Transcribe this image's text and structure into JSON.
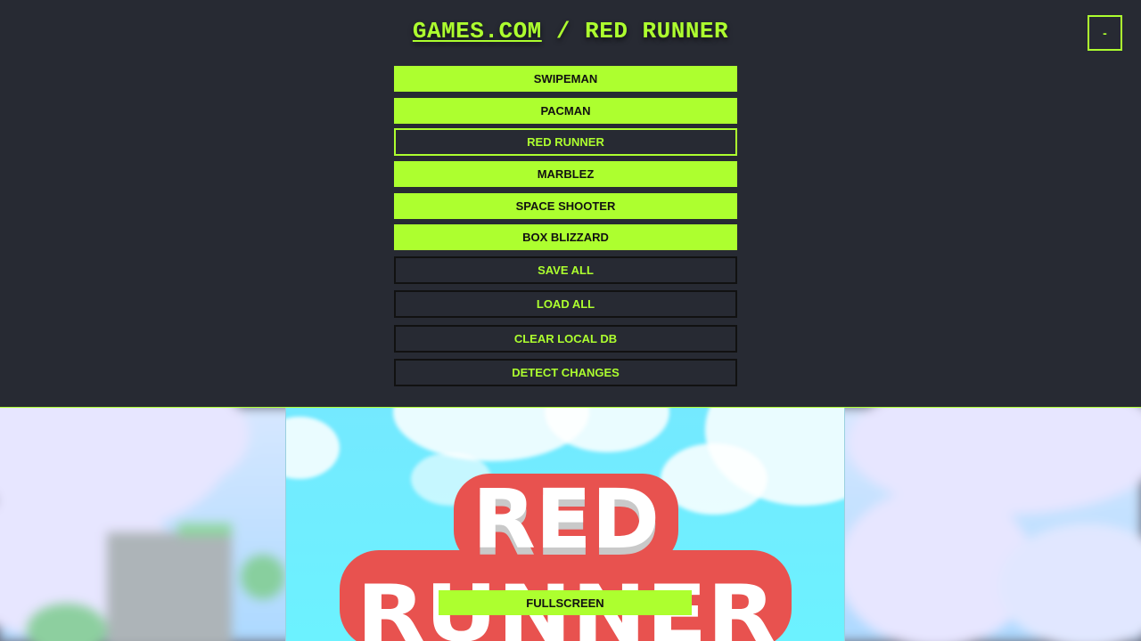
{
  "header": {
    "site_link": "GAMES.COM",
    "separator": " / ",
    "current_game": "RED RUNNER",
    "minimize_label": "-"
  },
  "menu": {
    "games": [
      {
        "label": "SWIPEMAN",
        "active": false
      },
      {
        "label": "PACMAN",
        "active": false
      },
      {
        "label": "RED RUNNER",
        "active": true
      },
      {
        "label": "MARBLEZ",
        "active": false
      },
      {
        "label": "SPACE SHOOTER",
        "active": false
      },
      {
        "label": "BOX BLIZZARD",
        "active": false
      }
    ],
    "actions": [
      {
        "label": "SAVE ALL"
      },
      {
        "label": "LOAD ALL"
      },
      {
        "label": "CLEAR LOCAL DB"
      },
      {
        "label": "DETECT CHANGES"
      }
    ]
  },
  "game": {
    "logo_line1": "RED",
    "logo_line2": "RUNNER",
    "fullscreen_label": "FULLSCREEN"
  },
  "colors": {
    "accent": "#adff2f",
    "background": "#272a33",
    "logo_red": "#e8524f",
    "sky": "#74e9ff"
  }
}
